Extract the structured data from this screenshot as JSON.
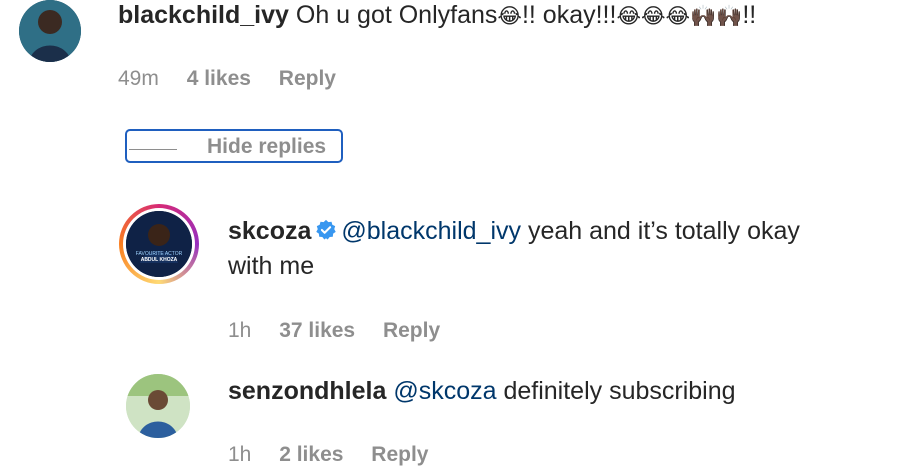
{
  "comments": [
    {
      "username": "blackchild_ivy",
      "text_start": "Oh u got Onlyfans",
      "emoji_1": "😂",
      "text_mid": "!! okay!!!",
      "emoji_2": "😂😂😂🙌🏿🙌🏿",
      "text_end": "!!",
      "time": "49m",
      "likes": "4 likes",
      "reply_label": "Reply"
    }
  ],
  "hide_replies_label": "Hide replies",
  "replies": [
    {
      "username": "skcoza",
      "verified": true,
      "mention": "@blackchild_ivy",
      "text_line1": "yeah and it’s totally okay",
      "text_line2": "with me",
      "time": "1h",
      "likes": "37 likes",
      "reply_label": "Reply",
      "avatar_caption_1": "FAVOURITE ACTOR",
      "avatar_caption_2": "ABDUL KHOZA"
    },
    {
      "username": "senzondhlela",
      "mention": "@skcoza",
      "text": "definitely subscribing",
      "time": "1h",
      "likes": "2 likes",
      "reply_label": "Reply"
    }
  ],
  "colors": {
    "text": "#262626",
    "meta": "#8e8e8e",
    "mention": "#00376b",
    "verified": "#3897f0",
    "focus_outline": "#1f5fbf"
  }
}
